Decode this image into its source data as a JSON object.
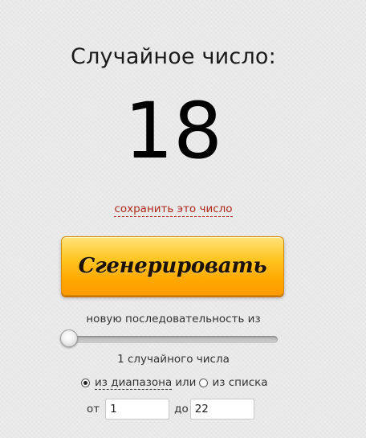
{
  "heading": "Случайное число:",
  "result": "18",
  "save_link": "сохранить это число",
  "generate_button": "Сгенерировать",
  "sequence_label": "новую последовательность из",
  "count_slider": {
    "value": 1,
    "min": 1,
    "max": 100
  },
  "count_label": "1 случайного числа",
  "mode": {
    "range_label": "из диапазона",
    "or_label": "или",
    "list_label": "из списка",
    "selected": "range"
  },
  "range": {
    "from_label": "от",
    "from_value": "1",
    "to_label": "до",
    "to_value": "22"
  },
  "colors": {
    "link": "#b0291b",
    "button_top": "#ffe37a",
    "button_bottom": "#ff9a00"
  }
}
